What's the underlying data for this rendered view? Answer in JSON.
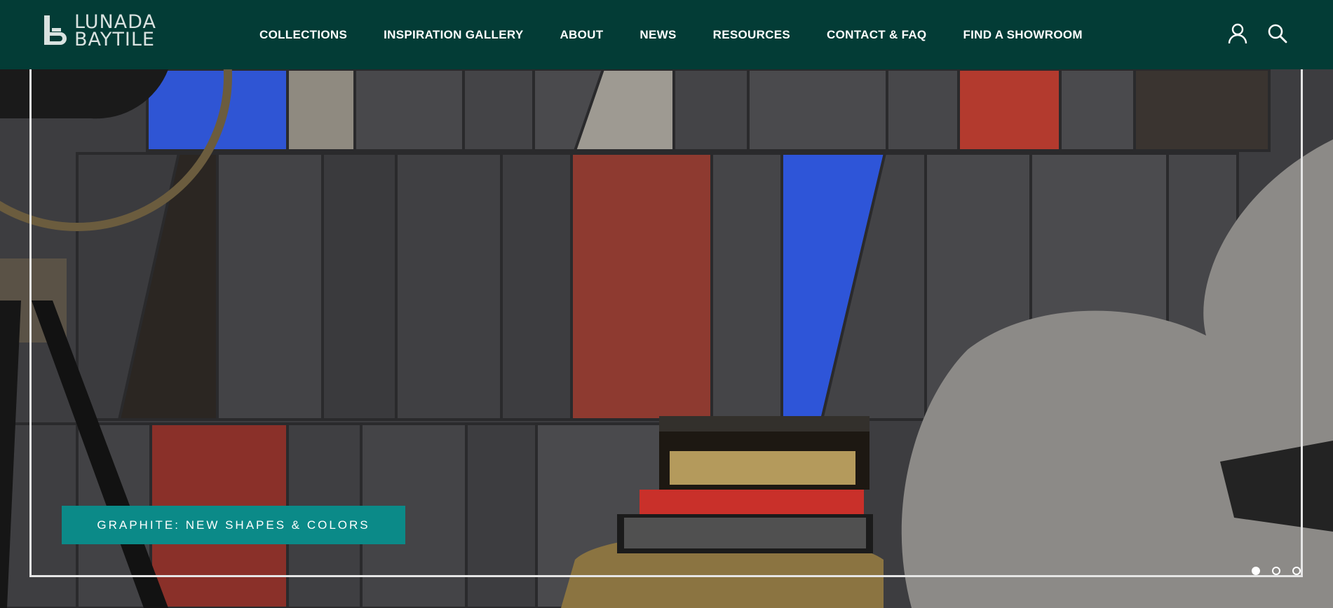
{
  "brand": {
    "line1": "LUNADA",
    "line2": "BAYTILE",
    "color": "#033c36"
  },
  "nav": {
    "items": [
      {
        "label": "COLLECTIONS"
      },
      {
        "label": "INSPIRATION GALLERY"
      },
      {
        "label": "ABOUT"
      },
      {
        "label": "NEWS"
      },
      {
        "label": "RESOURCES"
      },
      {
        "label": "CONTACT & FAQ"
      },
      {
        "label": "FIND A SHOWROOM"
      }
    ]
  },
  "header_icons": [
    "user-icon",
    "search-icon"
  ],
  "hero": {
    "caption": "GRAPHITE: NEW SHAPES & COLORS",
    "caption_color": "#0b8a88",
    "slides_count": 3,
    "active_slide": 1
  }
}
